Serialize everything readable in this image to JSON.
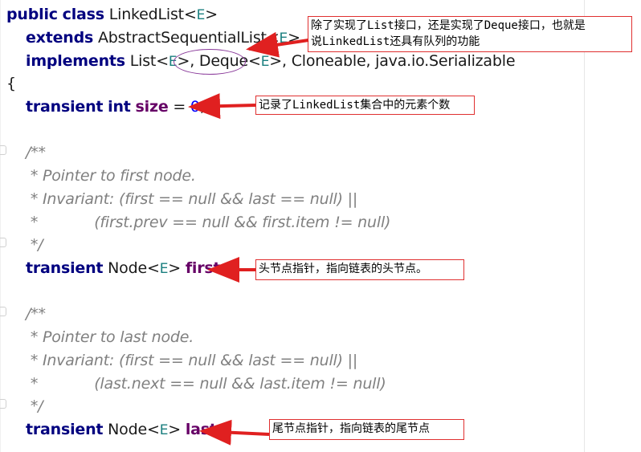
{
  "code": {
    "line1": {
      "kw1": "public",
      "kw2": "class",
      "name": "LinkedList",
      "lt": "<",
      "tp": "E",
      "gt": ">"
    },
    "line2": {
      "kw": "extends",
      "name": "AbstractSequentialList",
      "lt": "<",
      "tp": "E",
      "gt": ">"
    },
    "line3": {
      "kw": "implements",
      "list": "List",
      "lt1": "<",
      "tp1": "E",
      "gt1": ">",
      "sep1": ", ",
      "deque": "Deque",
      "lt2": "<",
      "tp2": "E",
      "gt2": ">",
      "rest": ", Cloneable, java.io.Serializable"
    },
    "line4": {
      "brace": "{"
    },
    "line5": {
      "kw1": "transient",
      "kw2": "int",
      "field": "size",
      "eq": " = ",
      "num": "0",
      "semi": ";"
    },
    "comment1": [
      "/**",
      " * Pointer to first node.",
      " * Invariant: (first == null && last == null) ||",
      " *            (first.prev == null && first.item != null)",
      " */"
    ],
    "line_first": {
      "kw": "transient",
      "type": "Node",
      "lt": "<",
      "tp": "E",
      "gt": ">",
      "field": "first",
      "semi": ";"
    },
    "comment2": [
      "/**",
      " * Pointer to last node.",
      " * Invariant: (first == null && last == null) ||",
      " *            (last.next == null && last.item != null)",
      " */"
    ],
    "line_last": {
      "kw": "transient",
      "type": "Node",
      "lt": "<",
      "tp": "E",
      "gt": ">",
      "field": "last",
      "semi": ";"
    }
  },
  "annotations": {
    "deque_note_line1": "除了实现了List接口，还是实现了Deque接口，也就是",
    "deque_note_line2": "说LinkedList还具有队列的功能",
    "size_note": "记录了LinkedList集合中的元素个数",
    "first_note": "头节点指针，指向链表的头节点。",
    "last_note": "尾节点指针，指向链表的尾节点"
  },
  "colors": {
    "keyword": "#00007f",
    "type_param": "#1a7f7f",
    "field": "#660066",
    "comment": "#808080",
    "annotation_border": "#e03030",
    "arrow": "#e02020",
    "ellipse": "#8a3a9a"
  }
}
